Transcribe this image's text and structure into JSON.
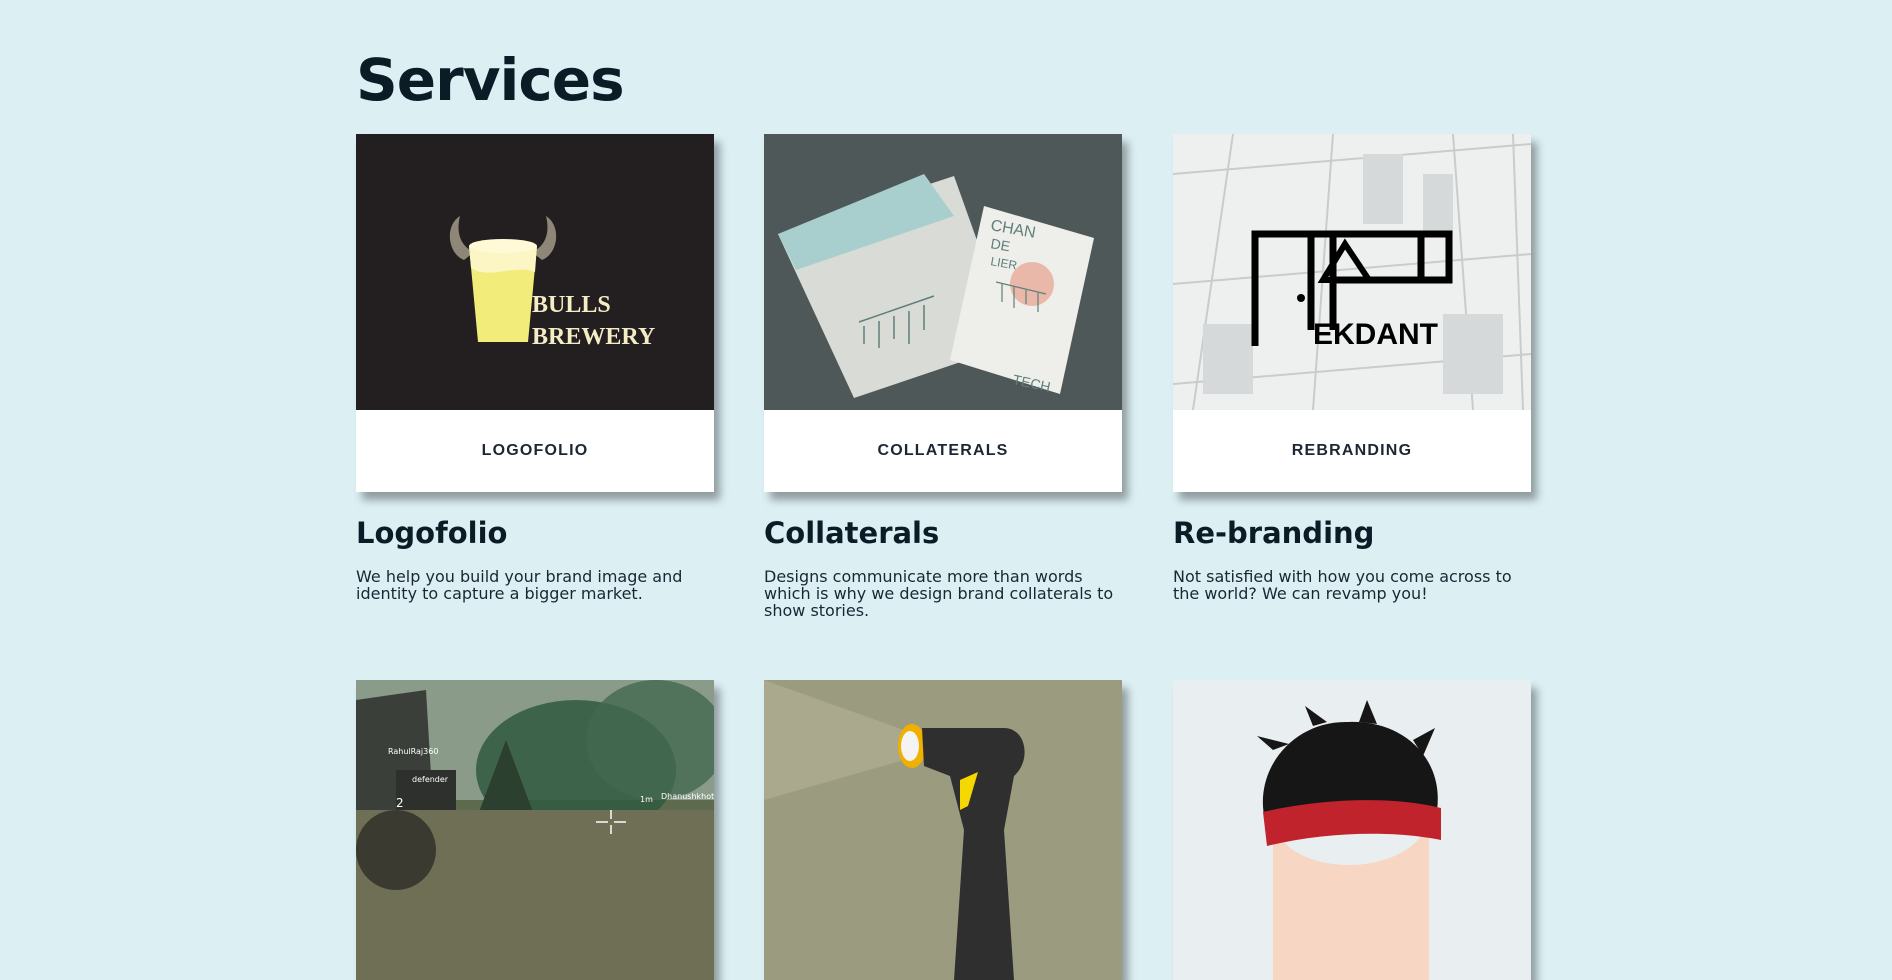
{
  "section": {
    "title": "Services"
  },
  "services": [
    {
      "label": "LOGOFOLIO",
      "title": "Logofolio",
      "description": "We help you build your brand image and identity to capture a bigger market.",
      "image": {
        "logo_line1": "BULLS",
        "logo_line2": "BREWERY"
      }
    },
    {
      "label": "COLLATERALS",
      "title": "Collaterals",
      "description": "Designs communicate more than words which is why we design brand collaterals to show stories.",
      "image": {
        "card_text1": "CHAN",
        "card_text2": "DE",
        "card_text3": "LIER",
        "card_text4": "TECH"
      }
    },
    {
      "label": "REBRANDING",
      "title": "Re-branding",
      "description": "Not satisfied with how you come across to the world? We can revamp you!",
      "image": {
        "logo_text": "EKDANT"
      }
    }
  ],
  "next_row": {
    "game_hud": {
      "player1": "RahulRaj360",
      "player2": "defender",
      "count": "2",
      "distance": "1m",
      "player3": "Dhanushkhot"
    }
  },
  "colors": {
    "background": "#dcf0f4",
    "heading": "#0c1c27",
    "card": "#ffffff",
    "bulls_bg": "#231f20",
    "collateral_bg": "#4f5859"
  }
}
